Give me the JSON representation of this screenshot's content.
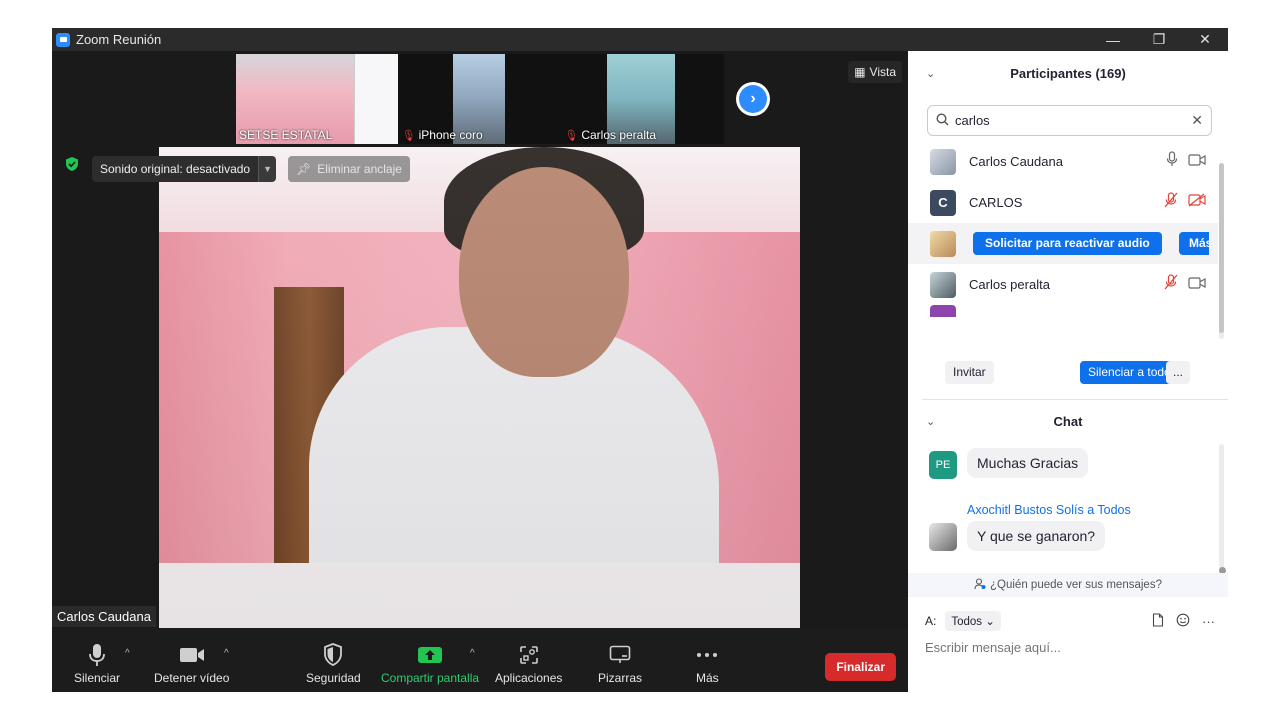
{
  "window": {
    "title": "Zoom Reunión",
    "controls": {
      "minimize": "—",
      "restore": "❐",
      "close": "✕"
    }
  },
  "gallery": {
    "thumbnails": [
      {
        "name": "SETSE ESTATAL",
        "muted": false
      },
      {
        "name": "iPhone coro",
        "muted": true
      },
      {
        "name": "Carlos peralta",
        "muted": true
      }
    ],
    "view_label": "Vista"
  },
  "main_video": {
    "sound_label": "Sonido original: desactivado",
    "unpin_label": "Eliminar anclaje",
    "speaker_name": "Carlos Caudana"
  },
  "toolbar": {
    "mute": "Silenciar",
    "stop_video": "Detener vídeo",
    "security": "Seguridad",
    "share": "Compartir pantalla",
    "apps": "Aplicaciones",
    "whiteboards": "Pizarras",
    "more": "Más",
    "end": "Finalizar"
  },
  "participants": {
    "header": "Participantes (169)",
    "search_value": "carlos",
    "rows": [
      {
        "name": "Carlos Caudana",
        "initial": "",
        "muted": false,
        "video_off": false
      },
      {
        "name": "CARLOS",
        "initial": "C",
        "muted": true,
        "video_off": true
      },
      {
        "name": "",
        "initial": "",
        "request_label": "Solicitar para reactivar audio",
        "more_label": "Más"
      },
      {
        "name": "Carlos peralta",
        "initial": "",
        "muted": true,
        "video_off": false
      }
    ],
    "invite": "Invitar",
    "mute_all": "Silenciar a todos",
    "more": "..."
  },
  "chat": {
    "header": "Chat",
    "messages": [
      {
        "avatar_initials": "PE",
        "sender": "",
        "text": "Muchas Gracias"
      },
      {
        "avatar_initials": "",
        "sender": "Axochitl Bustos Solís a Todos",
        "text": "Y que se ganaron?"
      }
    ],
    "who_sees": "¿Quién puede ver sus mensajes?",
    "to_label": "A:",
    "to_value": "Todos",
    "input_placeholder": "Escribir mensaje aquí..."
  },
  "colors": {
    "accent": "#0e71eb",
    "end": "#d72b2b",
    "share": "#2ecc71",
    "muted": "#e0453a"
  }
}
